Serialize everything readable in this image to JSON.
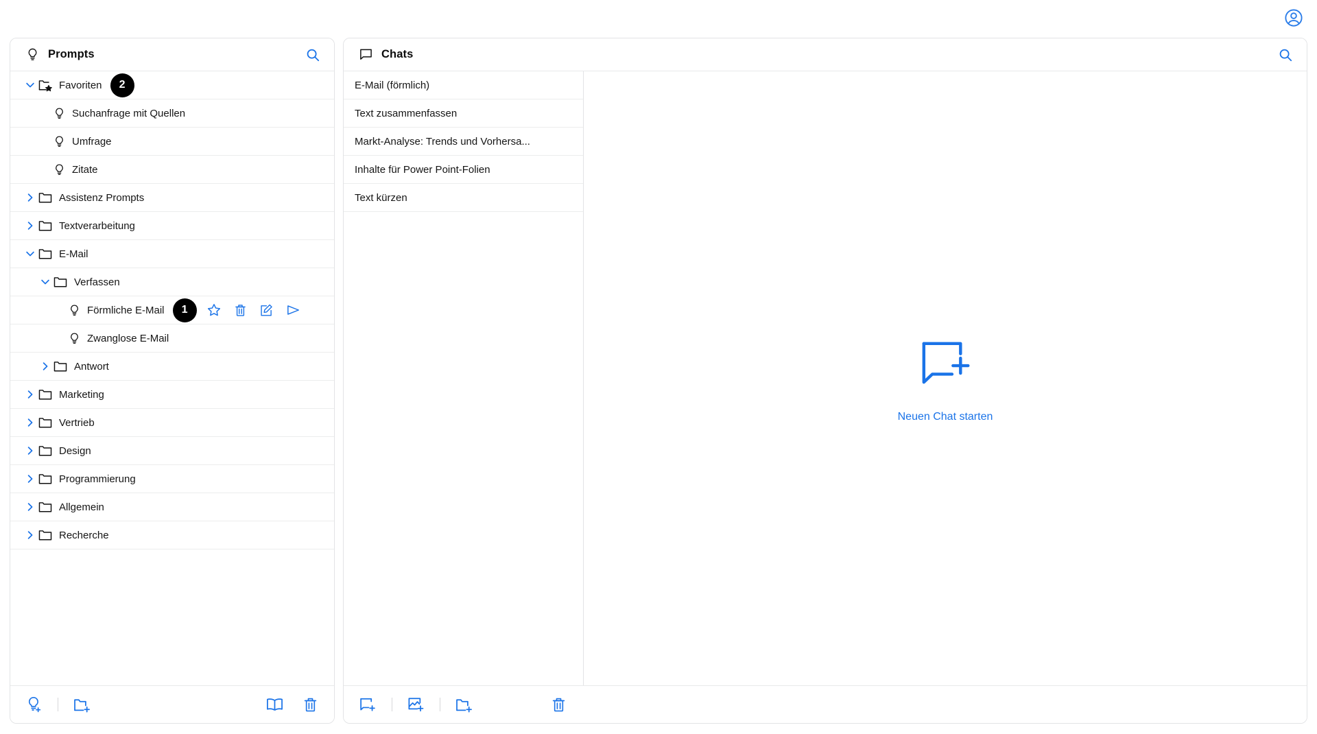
{
  "colors": {
    "accent": "#1a73e8",
    "text": "#151515",
    "border": "#e2e3e5",
    "badge_bg": "#000000"
  },
  "topbar": {
    "account_icon": "account-circle-icon"
  },
  "prompts_panel": {
    "title": "Prompts",
    "title_icon": "lightbulb-icon",
    "search_icon": "search-icon",
    "tree": [
      {
        "label": "Favoriten",
        "icon": "folder-star-icon",
        "depth": 0,
        "twisty": "down",
        "badge": "2"
      },
      {
        "label": "Suchanfrage mit Quellen",
        "icon": "lightbulb-icon",
        "depth": 1,
        "twisty": "none"
      },
      {
        "label": "Umfrage",
        "icon": "lightbulb-icon",
        "depth": 1,
        "twisty": "none"
      },
      {
        "label": "Zitate",
        "icon": "lightbulb-icon",
        "depth": 1,
        "twisty": "none"
      },
      {
        "label": "Assistenz Prompts",
        "icon": "folder-icon",
        "depth": 0,
        "twisty": "right"
      },
      {
        "label": "Textverarbeitung",
        "icon": "folder-icon",
        "depth": 0,
        "twisty": "right"
      },
      {
        "label": "E-Mail",
        "icon": "folder-icon",
        "depth": 0,
        "twisty": "down"
      },
      {
        "label": "Verfassen",
        "icon": "folder-icon",
        "depth": 2,
        "twisty": "down"
      },
      {
        "label": "Förmliche E-Mail",
        "icon": "lightbulb-icon",
        "depth": 3,
        "twisty": "none",
        "badge": "1",
        "actions": [
          "star-icon",
          "trash-icon",
          "edit-icon",
          "send-icon"
        ]
      },
      {
        "label": "Zwanglose E-Mail",
        "icon": "lightbulb-icon",
        "depth": 3,
        "twisty": "none"
      },
      {
        "label": "Antwort",
        "icon": "folder-icon",
        "depth": 2,
        "twisty": "right"
      },
      {
        "label": "Marketing",
        "icon": "folder-icon",
        "depth": 0,
        "twisty": "right"
      },
      {
        "label": "Vertrieb",
        "icon": "folder-icon",
        "depth": 0,
        "twisty": "right"
      },
      {
        "label": "Design",
        "icon": "folder-icon",
        "depth": 0,
        "twisty": "right"
      },
      {
        "label": "Programmierung",
        "icon": "folder-icon",
        "depth": 0,
        "twisty": "right"
      },
      {
        "label": "Allgemein",
        "icon": "folder-icon",
        "depth": 0,
        "twisty": "right"
      },
      {
        "label": "Recherche",
        "icon": "folder-icon",
        "depth": 0,
        "twisty": "right"
      }
    ],
    "footer": {
      "new_prompt_icon": "lightbulb-plus-icon",
      "new_folder_icon": "folder-plus-icon",
      "library_icon": "book-icon",
      "delete_icon": "trash-icon"
    }
  },
  "chats_panel": {
    "title": "Chats",
    "title_icon": "chat-bubble-icon",
    "search_icon": "search-icon",
    "chats": [
      "E-Mail (förmlich)",
      "Text zusammenfassen",
      "Markt-Analyse: Trends und Vorhersa...",
      "Inhalte für Power Point-Folien",
      "Text kürzen"
    ],
    "empty_state": {
      "icon": "chat-bubble-plus-icon",
      "label": "Neuen Chat starten"
    },
    "footer": {
      "new_chat_icon": "chat-bubble-plus-icon",
      "new_image_chat_icon": "image-plus-icon",
      "new_folder_icon": "folder-plus-icon",
      "delete_icon": "trash-icon"
    }
  }
}
